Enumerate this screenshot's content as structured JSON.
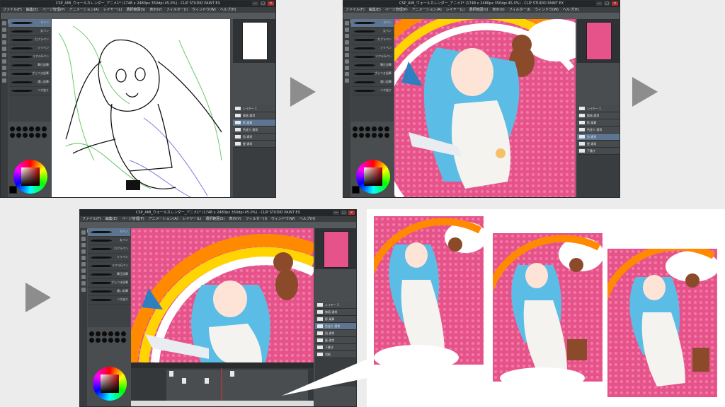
{
  "app": {
    "title_lines": [
      "CSP_AMI_ウォールカレンダー_アニメ1* (1748 x 2480px 350dpi 45.0%) - CLIP STUDIO PAINT EX",
      "CSP_AMI_ウォールカレンダー_アニメ1* (1748 x 2480px 350dpi 45.0%) - CLIP STUDIO PAINT EX",
      "CSP_AMI_ウォールカレンダー_アニメ1* (1748 x 2480px 350dpi 45.0%) - CLIP STUDIO PAINT EX"
    ],
    "menu": [
      "ファイル(F)",
      "編集(E)",
      "ページ管理(P)",
      "アニメーション(A)",
      "レイヤー(L)",
      "選択範囲(S)",
      "表示(V)",
      "フィルター(I)",
      "ウィンドウ(W)",
      "ヘルプ(H)"
    ],
    "window_controls": [
      "—",
      "□",
      "×"
    ]
  },
  "brushes": [
    "Gペン",
    "丸ペン",
    "カブラペン",
    "ミリペン",
    "リアルGペン",
    "筆圧鉛筆",
    "ざらつき鉛筆",
    "濃い鉛筆",
    "ベタ塗り"
  ],
  "layers": [
    "レイヤー 1",
    "線画 通常",
    "影 乗算",
    "色塗り 通常",
    "肌 通常",
    "髪 通常",
    "下書き",
    "用紙"
  ],
  "colors": {
    "canvas_pink": "#e5538a",
    "hair_blue": "#5bbde5",
    "ui_dark": "#3f4245",
    "arrow_gray": "#8d8d8d"
  },
  "icons": [
    "play-arrow-icon",
    "minimize-icon",
    "maximize-icon",
    "close-icon",
    "tool-icon"
  ]
}
